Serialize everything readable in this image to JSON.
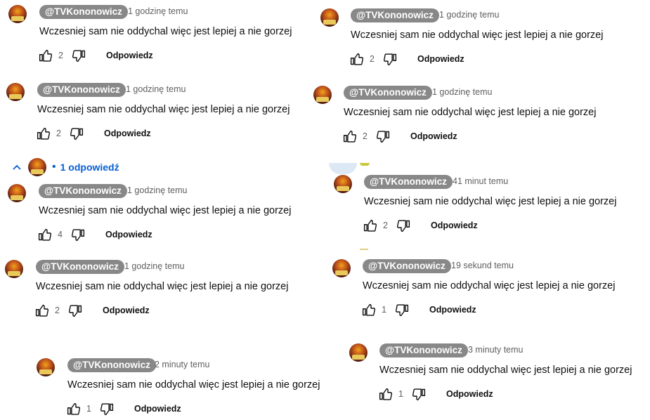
{
  "colors": {
    "link": "#065fd4",
    "author_bg": "#888888",
    "meta": "#606060"
  },
  "icons": {
    "like": "thumbs-up-icon",
    "dislike": "thumbs-down-icon",
    "collapse": "chevron-up-icon"
  },
  "comments": [
    {
      "author": "@TVKononowicz",
      "time": "1 godzinę temu",
      "text": "Wczesniej sam nie oddychal więc jest lepiej a nie gorzej",
      "likes": "2",
      "reply": "Odpowiedz"
    },
    {
      "author": "@TVKononowicz",
      "time": "1 godzinę temu",
      "text": "Wczesniej sam nie oddychal więc jest lepiej a nie gorzej",
      "likes": "2",
      "reply": "Odpowiedz"
    },
    {
      "author": "@TVKononowicz",
      "time": "1 godzinę temu",
      "text": "Wczesniej sam nie oddychal więc jest lepiej a nie gorzej",
      "likes": "4",
      "reply": "Odpowiedz"
    },
    {
      "author": "@TVKononowicz",
      "time": "1 godzinę temu",
      "text": "Wczesniej sam nie oddychal więc jest lepiej a nie gorzej",
      "likes": "2",
      "reply": "Odpowiedz"
    },
    {
      "author": "@TVKononowicz",
      "time": "2 minuty temu",
      "text": "Wczesniej sam nie oddychal więc jest lepiej a nie gorzej",
      "likes": "1",
      "reply": "Odpowiedz"
    },
    {
      "author": "@TVKononowicz",
      "time": "1 godzinę temu",
      "text": "Wczesniej sam nie oddychal więc jest lepiej a nie gorzej",
      "likes": "2",
      "reply": "Odpowiedz"
    },
    {
      "author": "@TVKononowicz",
      "time": "1 godzinę temu",
      "text": "Wczesniej sam nie oddychal więc jest lepiej a nie gorzej",
      "likes": "2",
      "reply": "Odpowiedz"
    },
    {
      "author": "@TVKononowicz",
      "time": "41 minut temu",
      "text": "Wczesniej sam nie oddychal więc jest lepiej a nie gorzej",
      "likes": "2",
      "reply": "Odpowiedz"
    },
    {
      "author": "@TVKononowicz",
      "time": "19 sekund temu",
      "text": "Wczesniej sam nie oddychal więc jest lepiej a nie gorzej",
      "likes": "1",
      "reply": "Odpowiedz"
    },
    {
      "author": "@TVKononowicz",
      "time": "3 minuty temu",
      "text": "Wczesniej sam nie oddychal więc jest lepiej a nie gorzej",
      "likes": "1",
      "reply": "Odpowiedz"
    }
  ],
  "replies_toggle": {
    "bullet": "•",
    "label": "1 odpowiedź"
  }
}
